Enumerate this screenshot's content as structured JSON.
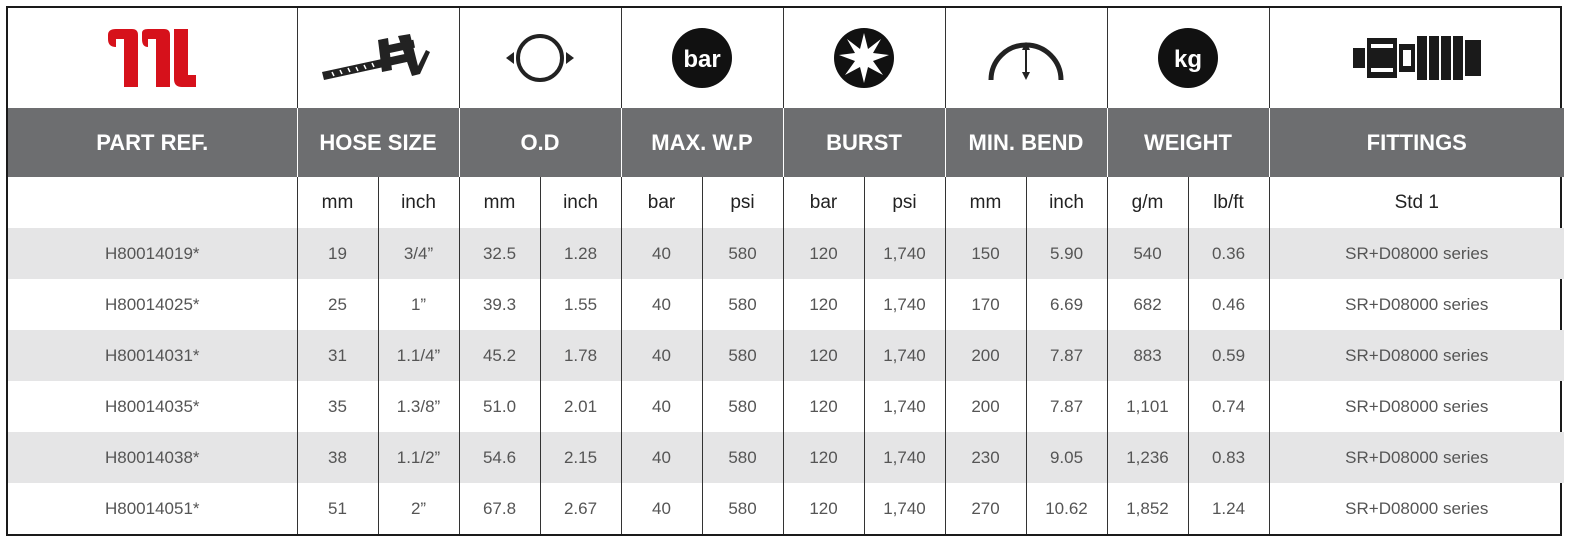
{
  "icons": {
    "brand": "brand-logo-icon",
    "hose_size": "caliper-icon",
    "od": "outer-diameter-icon",
    "max_wp": "bar-pressure-icon",
    "burst": "burst-icon",
    "min_bend": "bend-radius-icon",
    "weight": "kg-weight-icon",
    "fittings": "fitting-icon",
    "bar_text": "bar",
    "kg_text": "kg"
  },
  "headers": {
    "part_ref": "PART REF.",
    "hose_size": "HOSE SIZE",
    "od": "O.D",
    "max_wp": "MAX. W.P",
    "burst": "BURST",
    "min_bend": "MIN. BEND",
    "weight": "WEIGHT",
    "fittings": "FITTINGS"
  },
  "units": {
    "hose_mm": "mm",
    "hose_inch": "inch",
    "od_mm": "mm",
    "od_inch": "inch",
    "wp_bar": "bar",
    "wp_psi": "psi",
    "burst_bar": "bar",
    "burst_psi": "psi",
    "bend_mm": "mm",
    "bend_inch": "inch",
    "weight_gm": "g/m",
    "weight_lbft": "lb/ft",
    "fittings": "Std 1"
  },
  "rows": [
    {
      "part": "H80014019*",
      "hose_mm": "19",
      "hose_inch": "3/4”",
      "od_mm": "32.5",
      "od_inch": "1.28",
      "wp_bar": "40",
      "wp_psi": "580",
      "burst_bar": "120",
      "burst_psi": "1,740",
      "bend_mm": "150",
      "bend_inch": "5.90",
      "weight_gm": "540",
      "weight_lbft": "0.36",
      "fitting": "SR+D08000 series"
    },
    {
      "part": "H80014025*",
      "hose_mm": "25",
      "hose_inch": "1”",
      "od_mm": "39.3",
      "od_inch": "1.55",
      "wp_bar": "40",
      "wp_psi": "580",
      "burst_bar": "120",
      "burst_psi": "1,740",
      "bend_mm": "170",
      "bend_inch": "6.69",
      "weight_gm": "682",
      "weight_lbft": "0.46",
      "fitting": "SR+D08000 series"
    },
    {
      "part": "H80014031*",
      "hose_mm": "31",
      "hose_inch": "1.1/4”",
      "od_mm": "45.2",
      "od_inch": "1.78",
      "wp_bar": "40",
      "wp_psi": "580",
      "burst_bar": "120",
      "burst_psi": "1,740",
      "bend_mm": "200",
      "bend_inch": "7.87",
      "weight_gm": "883",
      "weight_lbft": "0.59",
      "fitting": "SR+D08000 series"
    },
    {
      "part": "H80014035*",
      "hose_mm": "35",
      "hose_inch": "1.3/8”",
      "od_mm": "51.0",
      "od_inch": "2.01",
      "wp_bar": "40",
      "wp_psi": "580",
      "burst_bar": "120",
      "burst_psi": "1,740",
      "bend_mm": "200",
      "bend_inch": "7.87",
      "weight_gm": "1,101",
      "weight_lbft": "0.74",
      "fitting": "SR+D08000 series"
    },
    {
      "part": "H80014038*",
      "hose_mm": "38",
      "hose_inch": "1.1/2”",
      "od_mm": "54.6",
      "od_inch": "2.15",
      "wp_bar": "40",
      "wp_psi": "580",
      "burst_bar": "120",
      "burst_psi": "1,740",
      "bend_mm": "230",
      "bend_inch": "9.05",
      "weight_gm": "1,236",
      "weight_lbft": "0.83",
      "fitting": "SR+D08000 series"
    },
    {
      "part": "H80014051*",
      "hose_mm": "51",
      "hose_inch": "2”",
      "od_mm": "67.8",
      "od_inch": "2.67",
      "wp_bar": "40",
      "wp_psi": "580",
      "burst_bar": "120",
      "burst_psi": "1,740",
      "bend_mm": "270",
      "bend_inch": "10.62",
      "weight_gm": "1,852",
      "weight_lbft": "1.24",
      "fitting": "SR+D08000 series"
    }
  ],
  "colors": {
    "header_bg": "#6d6e70",
    "alt_row_bg": "#e5e5e6",
    "brand_red": "#d6111b"
  }
}
